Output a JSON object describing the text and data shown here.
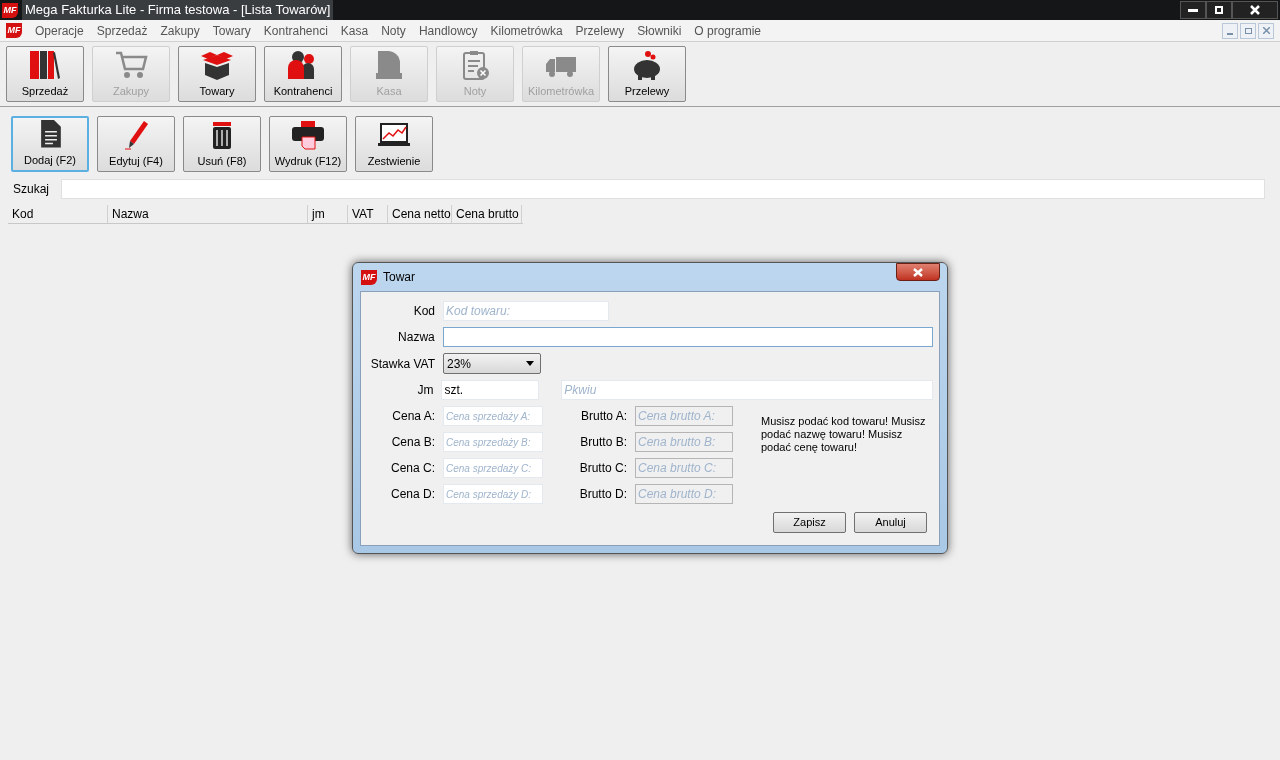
{
  "window": {
    "title": "Mega Fakturka Lite - Firma testowa - [Lista Towarów]",
    "logo": "MF"
  },
  "menu": {
    "logo": "MF",
    "items": [
      "Operacje",
      "Sprzedaż",
      "Zakupy",
      "Towary",
      "Kontrahenci",
      "Kasa",
      "Noty",
      "Handlowcy",
      "Kilometrówka",
      "Przelewy",
      "Słowniki",
      "O programie"
    ]
  },
  "module_toolbar": [
    {
      "label": "Sprzedaż",
      "kind": "binders",
      "disabled": false
    },
    {
      "label": "Zakupy",
      "kind": "cart",
      "disabled": true
    },
    {
      "label": "Towary",
      "kind": "box",
      "disabled": false
    },
    {
      "label": "Kontrahenci",
      "kind": "people",
      "disabled": false
    },
    {
      "label": "Kasa",
      "kind": "register",
      "disabled": true
    },
    {
      "label": "Noty",
      "kind": "note",
      "disabled": true
    },
    {
      "label": "Kilometrówka",
      "kind": "truck",
      "disabled": true
    },
    {
      "label": "Przelewy",
      "kind": "piggy",
      "disabled": false
    }
  ],
  "action_toolbar": [
    {
      "label": "Dodaj (F2)",
      "kind": "document",
      "focused": true
    },
    {
      "label": "Edytuj (F4)",
      "kind": "pen",
      "focused": false
    },
    {
      "label": "Usuń (F8)",
      "kind": "trash",
      "focused": false
    },
    {
      "label": "Wydruk (F12)",
      "kind": "printer",
      "focused": false
    },
    {
      "label": "Zestwienie",
      "kind": "chart",
      "focused": false
    }
  ],
  "search": {
    "label": "Szukaj"
  },
  "table": {
    "columns": [
      "Kod",
      "Nazwa",
      "jm",
      "VAT",
      "Cena netto",
      "Cena brutto"
    ]
  },
  "dialog": {
    "title": "Towar",
    "logo": "MF",
    "kod": {
      "label": "Kod",
      "placeholder": "Kod towaru:"
    },
    "nazwa": {
      "label": "Nazwa",
      "focused": true
    },
    "vat": {
      "label": "Stawka VAT",
      "value": "23%"
    },
    "jm": {
      "label": "Jm",
      "value": "szt."
    },
    "pkwiu": {
      "placeholder": "Pkwiu"
    },
    "prices": [
      {
        "label": "Cena A:",
        "placeholder": "Cena sprzedaży A:",
        "brutto_label": "Brutto A:",
        "brutto_placeholder": "Cena brutto A:"
      },
      {
        "label": "Cena B:",
        "placeholder": "Cena sprzedaży B:",
        "brutto_label": "Brutto B:",
        "brutto_placeholder": "Cena brutto B:"
      },
      {
        "label": "Cena C:",
        "placeholder": "Cena sprzedaży C:",
        "brutto_label": "Brutto C:",
        "brutto_placeholder": "Cena brutto C:"
      },
      {
        "label": "Cena D:",
        "placeholder": "Cena sprzedaży D:",
        "brutto_label": "Brutto D:",
        "brutto_placeholder": "Cena brutto D:"
      }
    ],
    "message": "Musisz podać kod towaru! Musisz podać nazwę towaru! Musisz podać cenę towaru!",
    "buttons": [
      "Zapisz",
      "Anuluj"
    ]
  }
}
